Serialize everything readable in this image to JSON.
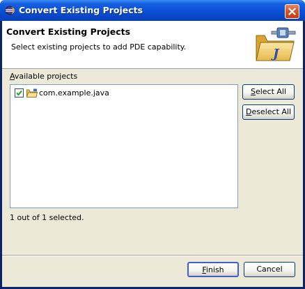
{
  "window": {
    "title": "Convert Existing Projects",
    "title_icon": "eclipse-icon",
    "close_icon": "close-icon"
  },
  "banner": {
    "title": "Convert Existing Projects",
    "description": "Select existing projects to add PDE capability.",
    "image": "java-project-folder-icon"
  },
  "projects": {
    "label_mnemonic": "A",
    "label_rest": "vailable projects",
    "items": [
      {
        "name": "com.example.java",
        "checked": true,
        "icon": "project-folder-icon"
      }
    ]
  },
  "buttons": {
    "select_all": {
      "mnemonic": "S",
      "rest": "elect All"
    },
    "deselect_all": {
      "mnemonic": "D",
      "rest": "eselect All"
    },
    "finish": {
      "mnemonic": "F",
      "rest": "inish"
    },
    "cancel": "Cancel"
  },
  "status": "1 out of 1 selected.",
  "colors": {
    "title_bar": "#0a4fd6",
    "dialog_bg": "#ece9d8",
    "close_button": "#d5532c",
    "list_border": "#7f9db9"
  }
}
